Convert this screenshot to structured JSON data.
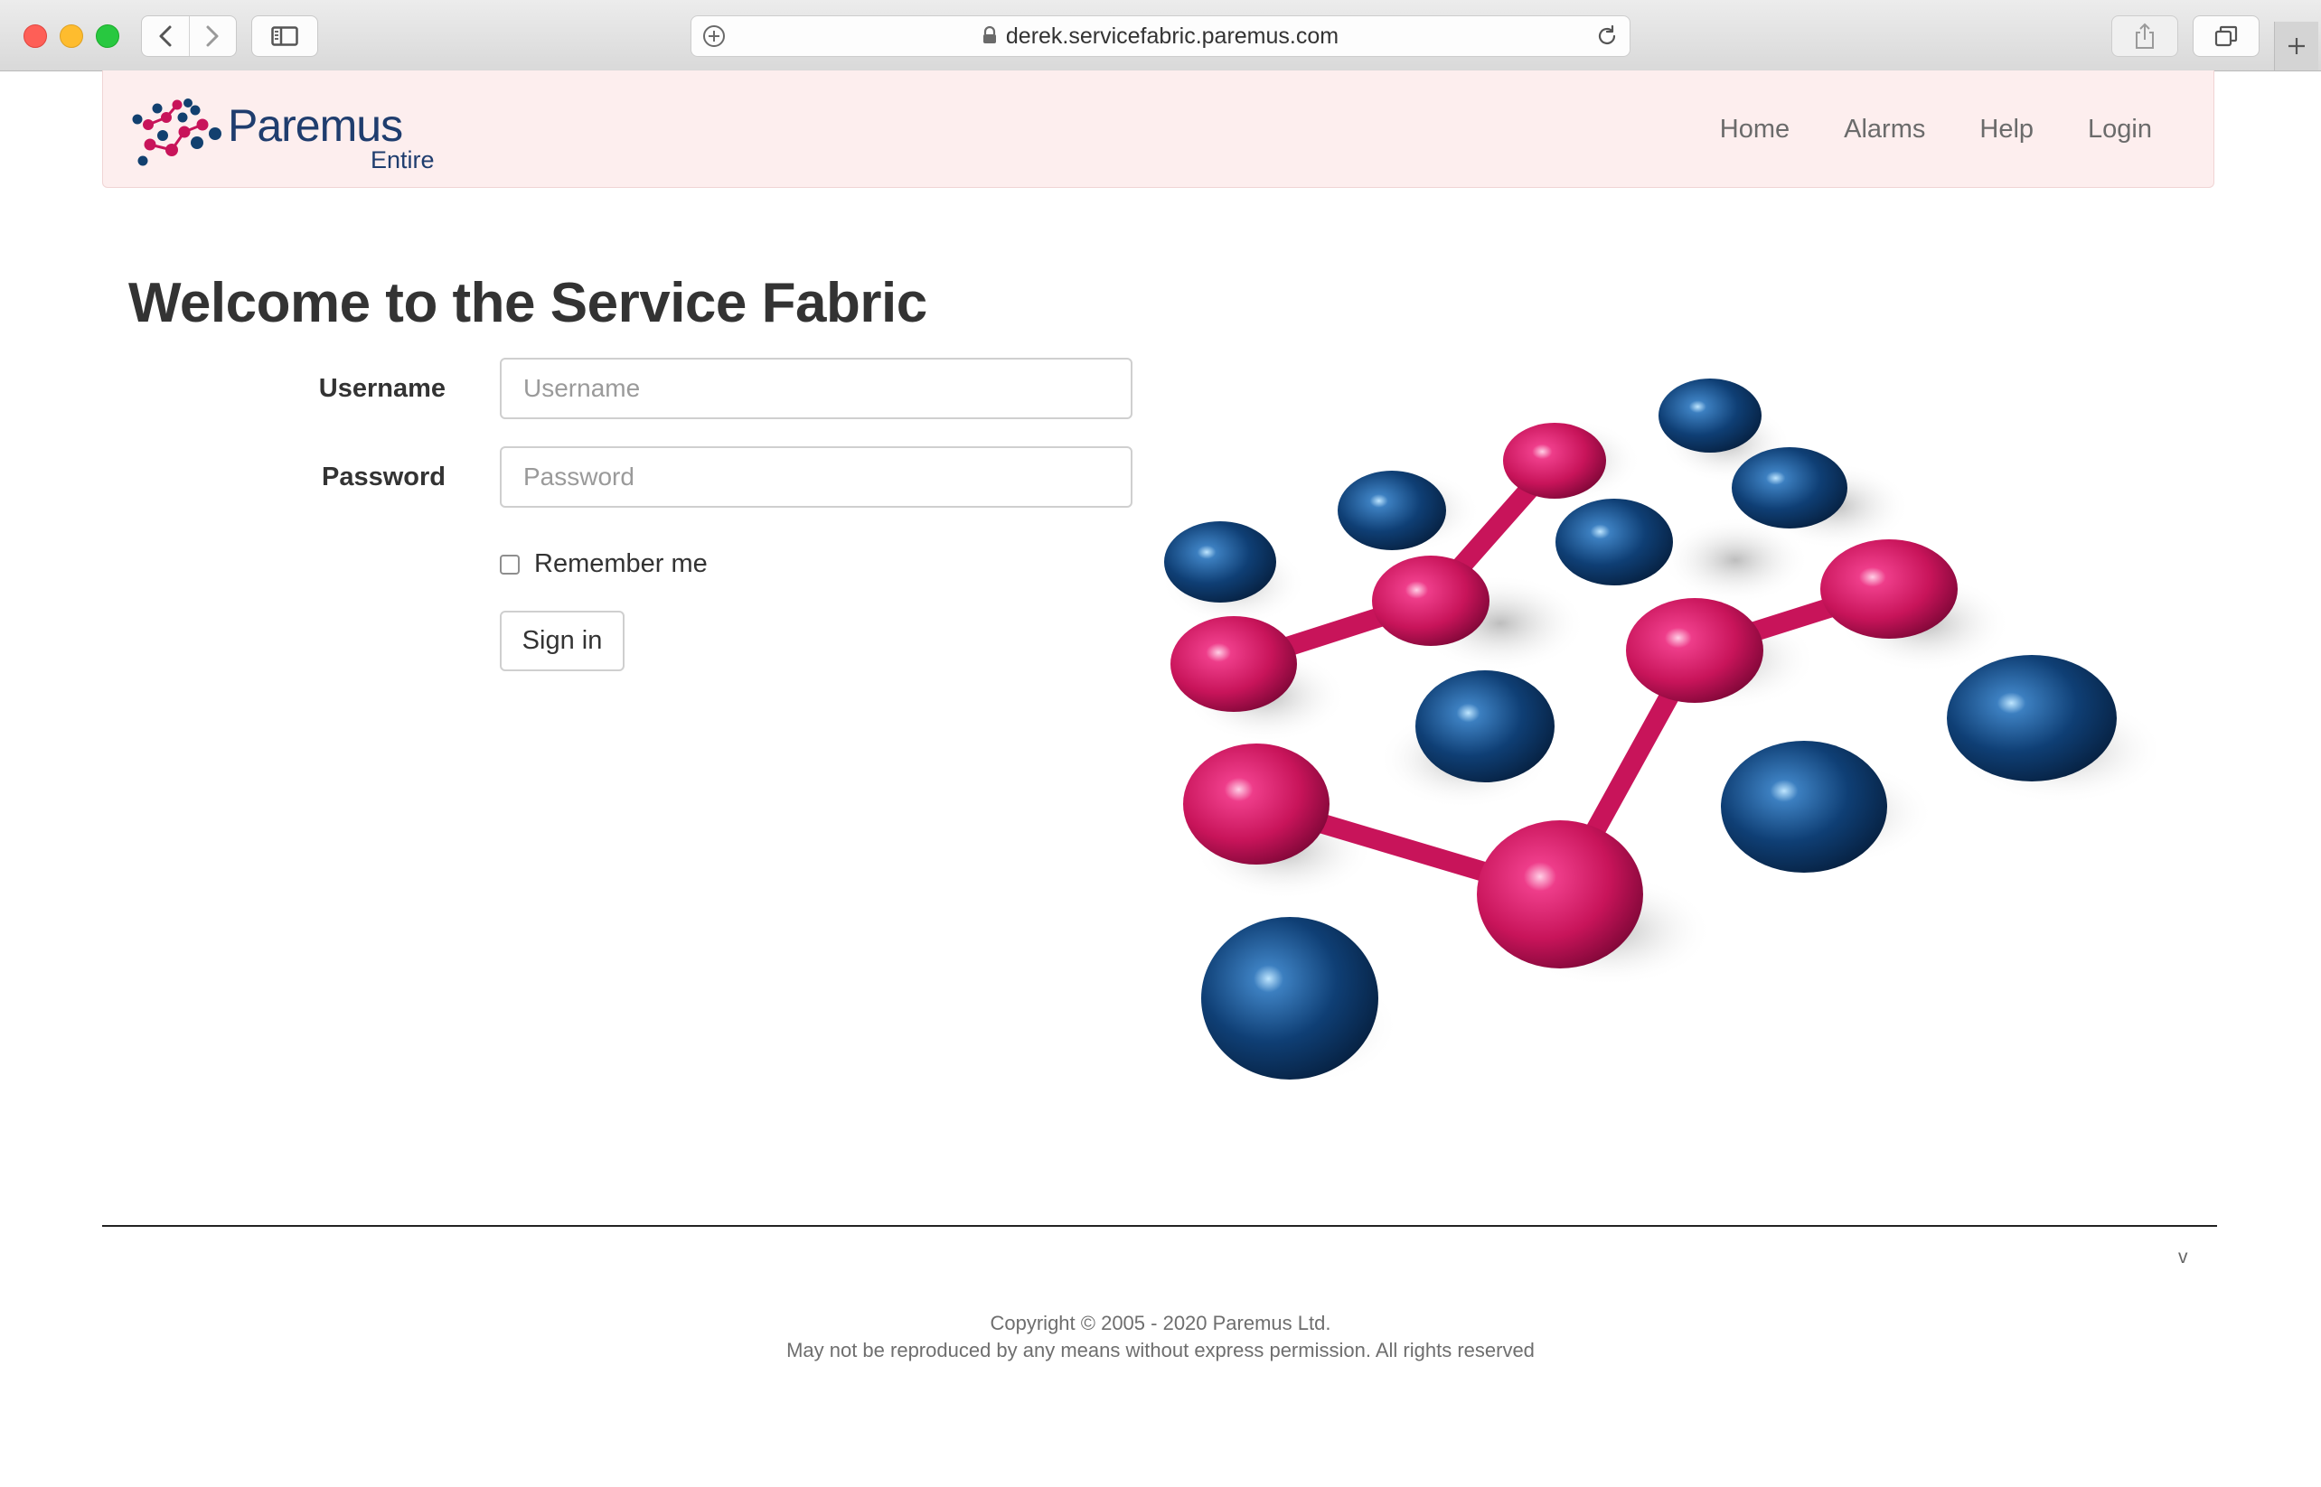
{
  "browser": {
    "url": "derek.servicefabric.paremus.com",
    "icons": [
      "back-icon",
      "forward-icon",
      "sidebar-icon",
      "plus-circle-icon",
      "lock-icon",
      "reload-icon",
      "share-icon",
      "tabs-icon",
      "new-tab-icon"
    ]
  },
  "header": {
    "brand_name": "Paremus",
    "brand_sub": "Entire",
    "nav": [
      {
        "label": "Home"
      },
      {
        "label": "Alarms"
      },
      {
        "label": "Help"
      },
      {
        "label": "Login"
      }
    ]
  },
  "main": {
    "title": "Welcome to the Service Fabric",
    "username_label": "Username",
    "username_placeholder": "Username",
    "username_value": "",
    "password_label": "Password",
    "password_placeholder": "Password",
    "password_value": "",
    "remember_label": "Remember me",
    "remember_checked": false,
    "signin_label": "Sign in"
  },
  "footer": {
    "version": "v",
    "copyright": "Copyright © 2005 - 2020 Paremus Ltd.",
    "rights": "May not be reproduced by any means without express permission. All rights reserved"
  },
  "colors": {
    "navbar_bg": "#fdeeee",
    "brand_blue": "#1f3d6e",
    "magenta": "#c8145a",
    "navy": "#0f3a6b"
  }
}
